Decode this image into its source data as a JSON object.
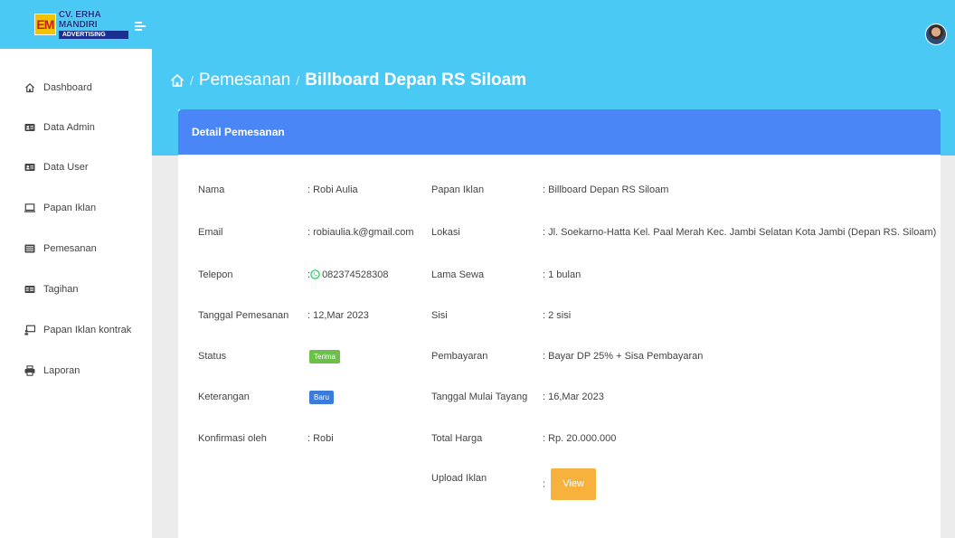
{
  "brand": {
    "title": "CV. ERHA MANDIRI",
    "subtitle": "ADVERTISING",
    "mark": "EM"
  },
  "sidebar": {
    "items": [
      {
        "label": "Dashboard",
        "icon": "home-icon"
      },
      {
        "label": "Data Admin",
        "icon": "id-card-icon"
      },
      {
        "label": "Data User",
        "icon": "id-card-icon"
      },
      {
        "label": "Papan Iklan",
        "icon": "monitor-icon"
      },
      {
        "label": "Pemesanan",
        "icon": "list-alt-icon"
      },
      {
        "label": "Tagihan",
        "icon": "credit-card-icon"
      },
      {
        "label": "Papan Iklan kontrak",
        "icon": "presentation-icon"
      },
      {
        "label": "Laporan",
        "icon": "printer-icon"
      }
    ]
  },
  "breadcrumb": {
    "level1": "Pemesanan",
    "current": "Billboard Depan RS Siloam",
    "separator": "/"
  },
  "card": {
    "title": "Detail Pemesanan",
    "left": [
      {
        "label": "Nama",
        "value": ": Robi Aulia"
      },
      {
        "label": "Email",
        "value": ": robiaulia.k@gmail.com"
      },
      {
        "label": "Telepon",
        "value_prefix": ":",
        "value": "082374528308"
      },
      {
        "label": "Tanggal Pemesanan",
        "value": ": 12,Mar 2023"
      },
      {
        "label": "Status",
        "badge": "Terima"
      },
      {
        "label": "Keterangan",
        "badge": "Baru"
      },
      {
        "label": "Konfirmasi oleh",
        "value": ": Robi"
      }
    ],
    "right": [
      {
        "label": "Papan Iklan",
        "value": ": Billboard Depan RS Siloam"
      },
      {
        "label": "Lokasi",
        "value": ": Jl. Soekarno-Hatta Kel. Paal Merah Kec. Jambi Selatan Kota Jambi (Depan RS. Siloam)"
      },
      {
        "label": "Lama Sewa",
        "value": ": 1 bulan"
      },
      {
        "label": "Sisi",
        "value": ": 2 sisi"
      },
      {
        "label": "Pembayaran",
        "value": ": Bayar DP 25% + Sisa Pembayaran"
      },
      {
        "label": "Tanggal Mulai Tayang",
        "value": ": 16,Mar 2023"
      },
      {
        "label": "Total Harga",
        "value": ": Rp. 20.000.000"
      },
      {
        "label": "Upload Iklan",
        "value_prefix": ":",
        "button": "View"
      }
    ]
  },
  "colors": {
    "top_band": "#49c9f4",
    "card_header": "#4a86f5",
    "badge_terima": "#6cc04a",
    "badge_baru": "#3a7bdc",
    "view_button": "#f6b23c",
    "whatsapp": "#25d366"
  }
}
